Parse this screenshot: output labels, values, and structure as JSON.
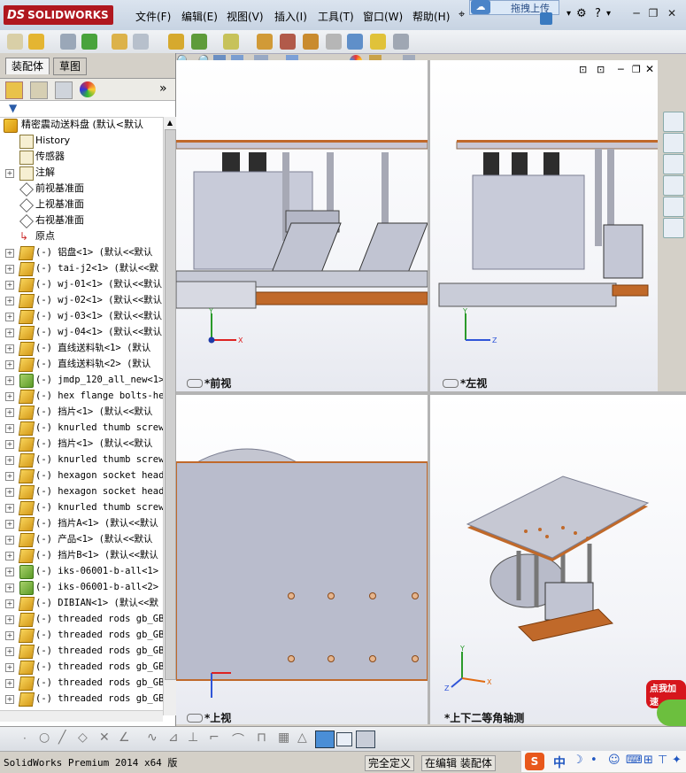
{
  "app": {
    "brand_ds": "DS",
    "brand_name": "SOLIDWORKS"
  },
  "menu": [
    "文件(F)",
    "编辑(E)",
    "视图(V)",
    "插入(I)",
    "工具(T)",
    "窗口(W)",
    "帮助(H)"
  ],
  "upload_overlay": "拖拽上传",
  "help_symbol": "?",
  "panel": {
    "tab_assembly": "装配体",
    "tab_sketch": "草图",
    "expand_arrow": "»"
  },
  "tree": {
    "root": "精密震动送料盘  (默认<默认",
    "items": [
      {
        "label": "History",
        "icon": "history-icon",
        "expand": false
      },
      {
        "label": "传感器",
        "icon": "sensor-icon",
        "expand": false
      },
      {
        "label": "注解",
        "icon": "annotation-icon",
        "expand": true
      },
      {
        "label": "前视基准面",
        "icon": "plane-icon",
        "expand": false
      },
      {
        "label": "上视基准面",
        "icon": "plane-icon",
        "expand": false
      },
      {
        "label": "右视基准面",
        "icon": "plane-icon",
        "expand": false
      },
      {
        "label": "原点",
        "icon": "origin-icon",
        "expand": false
      },
      {
        "label": "(-) 铝盘<1> (默认<<默认",
        "icon": "part-icon",
        "expand": true
      },
      {
        "label": "(-) tai-j2<1> (默认<<默",
        "icon": "part-icon",
        "expand": true
      },
      {
        "label": "(-) wj-01<1> (默认<<默认",
        "icon": "part-icon",
        "expand": true
      },
      {
        "label": "(-) wj-02<1> (默认<<默认",
        "icon": "part-icon",
        "expand": true
      },
      {
        "label": "(-) wj-03<1> (默认<<默认",
        "icon": "part-icon",
        "expand": true
      },
      {
        "label": "(-) wj-04<1> (默认<<默认",
        "icon": "part-icon",
        "expand": true
      },
      {
        "label": "(-) 直线送料轨<1> (默认",
        "icon": "part-icon",
        "expand": true
      },
      {
        "label": "(-) 直线送料轨<2> (默认",
        "icon": "part-icon",
        "expand": true
      },
      {
        "label": "(-) jmdp_120_all_new<1>",
        "icon": "subassembly-icon",
        "expand": true
      },
      {
        "label": "(-) hex flange bolts-he",
        "icon": "part-icon",
        "expand": true
      },
      {
        "label": "(-) 挡片<1> (默认<<默认",
        "icon": "part-icon",
        "expand": true
      },
      {
        "label": "(-) knurled thumb screw",
        "icon": "part-icon",
        "expand": true
      },
      {
        "label": "(-) 挡片<1> (默认<<默认",
        "icon": "part-icon",
        "expand": true
      },
      {
        "label": "(-) knurled thumb screw",
        "icon": "part-icon",
        "expand": true
      },
      {
        "label": "(-) hexagon socket head",
        "icon": "part-icon",
        "expand": true
      },
      {
        "label": "(-) hexagon socket head",
        "icon": "part-icon",
        "expand": true
      },
      {
        "label": "(-) knurled thumb screw",
        "icon": "part-icon",
        "expand": true
      },
      {
        "label": "(-) 挡片A<1> (默认<<默认",
        "icon": "part-icon",
        "expand": true
      },
      {
        "label": "(-) 产品<1> (默认<<默认",
        "icon": "part-icon",
        "expand": true
      },
      {
        "label": "(-) 挡片B<1> (默认<<默认",
        "icon": "part-icon",
        "expand": true
      },
      {
        "label": "(-) iks-06001-b-all<1>",
        "icon": "subassembly-icon",
        "expand": true
      },
      {
        "label": "(-) iks-06001-b-all<2>",
        "icon": "subassembly-icon",
        "expand": true
      },
      {
        "label": "(-) DIBIAN<1> (默认<<默",
        "icon": "part-icon",
        "expand": true
      },
      {
        "label": "(-) threaded rods gb_GB",
        "icon": "part-icon",
        "expand": true
      },
      {
        "label": "(-) threaded rods gb_GB",
        "icon": "part-icon",
        "expand": true
      },
      {
        "label": "(-) threaded rods gb_GB",
        "icon": "part-icon",
        "expand": true
      },
      {
        "label": "(-) threaded rods gb_GB",
        "icon": "part-icon",
        "expand": true
      },
      {
        "label": "(-) threaded rods gb_GB",
        "icon": "part-icon",
        "expand": true
      },
      {
        "label": "(-) threaded rods gb_GB",
        "icon": "part-icon",
        "expand": true
      }
    ]
  },
  "viewports": {
    "front": "*前视",
    "left": "*左视",
    "top": "*上视",
    "iso": "*上下二等角轴测"
  },
  "axes": {
    "x": "X",
    "y": "Y",
    "z": "Z"
  },
  "status": {
    "product": "SolidWorks Premium 2014 x64 版",
    "defined": "完全定义",
    "editing": "在编辑 装配体"
  },
  "ime": {
    "lang": "中",
    "logo": "S"
  },
  "ad": {
    "label": "点我加速"
  },
  "colors": {
    "accent_orange": "#c0692a",
    "plate_gray": "#b9bccc",
    "brand_red": "#b0171f"
  }
}
